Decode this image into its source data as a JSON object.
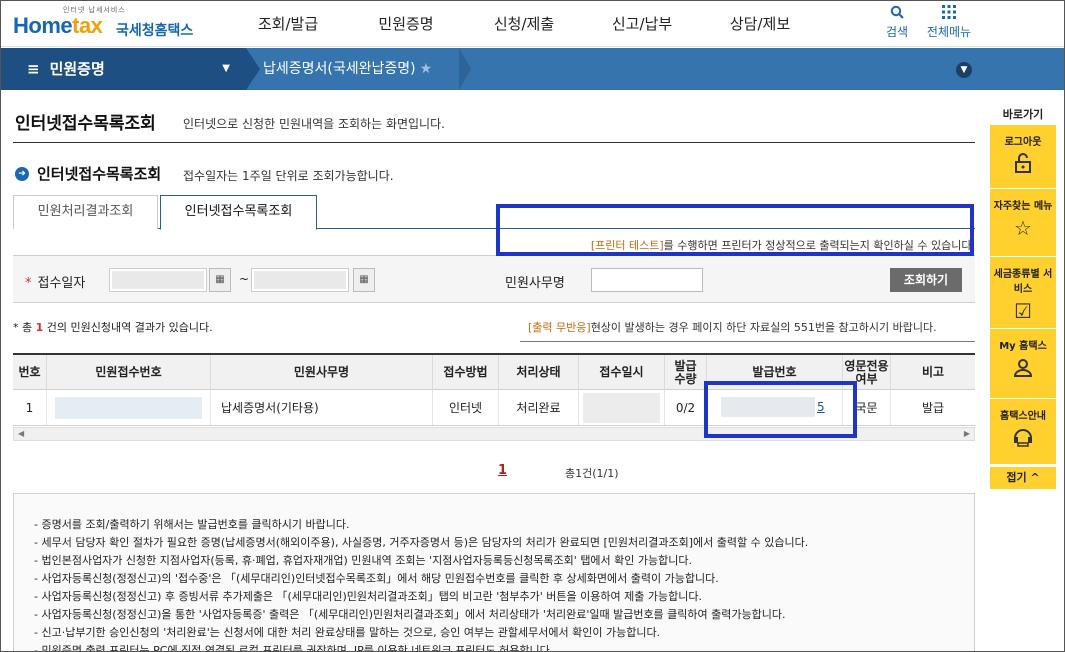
{
  "header": {
    "logo_tagline": "인터넷 납세서비스",
    "logo_brand_a": "Home",
    "logo_brand_b": "tax",
    "logo_kr": "국세청홈택스",
    "menu": [
      "조회/발급",
      "민원증명",
      "신청/제출",
      "신고/납부",
      "상담/제보"
    ],
    "search_label": "검색",
    "allmenu_label": "전체메뉴"
  },
  "location": {
    "level1": "민원증명",
    "level2": "납세증명서(국세완납증명)"
  },
  "page": {
    "title": "인터넷접수목록조회",
    "desc": "인터넷으로 신청한 민원내역을 조회하는 화면입니다.",
    "section_title": "인터넷접수목록조회",
    "section_desc": "접수일자는 1주일 단위로 조회가능합니다."
  },
  "tabs": [
    {
      "label": "민원처리결과조회",
      "active": false
    },
    {
      "label": "인터넷접수목록조회",
      "active": true
    }
  ],
  "printer_notice": {
    "highlight": "[프린터 테스트]",
    "text": "를 수행하면 프린터가 정상적으로 출력되는지 확인하실 수 있습니다."
  },
  "search": {
    "date_label": "접수일자",
    "tilde": "~",
    "office_label": "민원사무명",
    "button": "조회하기"
  },
  "result": {
    "prefix": "* 총 ",
    "count": "1",
    "suffix": " 건의 민원신청내역 결과가 있습니다."
  },
  "warning": {
    "highlight": "[출력 무반응]",
    "text": "현상이 발생하는 경우 페이지 하단 자료실의 551번을 참고하시기 바랍니다."
  },
  "table": {
    "headers": [
      "번호",
      "민원접수번호",
      "민원사무명",
      "접수방법",
      "처리상태",
      "접수일시",
      "발급\n수량",
      "발급번호",
      "영문전용\n여부",
      "비고"
    ],
    "rows": [
      {
        "no": "1",
        "office": "납세증명서(기타용)",
        "method": "인터넷",
        "status": "처리완료",
        "qty": "0/2",
        "issue_suffix": "5",
        "lang": "국문",
        "note": "발급"
      }
    ]
  },
  "paging": {
    "current": "1",
    "total": "총1건(1/1)"
  },
  "info": [
    "- 증명서를 조회/출력하기 위해서는 발급번호를 클릭하시기 바랍니다.",
    "- 세무서 담당자 확인 절차가 필요한 증명(납세증명서(해외이주용), 사실증명, 거주자증명서 등)은 담당자의 처리가 완료되면 [민원처리결과조회]에서 출력할 수 있습니다.",
    "- 법인본점사업자가 신청한 지점사업자(등록, 휴·폐업, 휴업자재개업) 민원내역 조회는 '지점사업자등록등신청목록조회' 탭에서 확인 가능합니다.",
    "- 사업자등록신청(정정신고)의 '접수중'은 「(세무대리인)인터넷접수목록조회」에서 해당 민원접수번호를 클릭한 후 상세화면에서 출력이 가능합니다.",
    "- 사업자등록신청(정정신고) 후 증빙서류 추가제출은 「(세무대리인)민원처리결과조회」탭의 비고란 '첨부추가' 버튼을 이용하여 제출 가능합니다.",
    "- 사업자등록신청(정정신고)을 통한 '사업자등록증' 출력은 「(세무대리인)민원처리결과조회」에서 처리상태가 '처리완료'일때 발급번호를 클릭하여 출력가능합니다.",
    "- 신고·납부기한 승인신청의 '처리완료'는 신청서에 대한 처리 완료상태를 말하는 것으로, 승인 여부는 관할세무서에서 확인이 가능합니다.",
    "- 민원증명 출력 프린터는 PC에 직접 연결된 로컬 프린터를 권장하며, IP를 이용한 네트워크 프린터도 허용합니다."
  ],
  "quick": {
    "head": "바로가기",
    "items": [
      "로그아웃",
      "자주찾는 메뉴",
      "세금종류별 서비스",
      "My 홈택스",
      "홈택스안내"
    ],
    "close": "접기 ^"
  },
  "colors": {
    "brand": "#1667b5",
    "locbar": "#3574ad",
    "locbar_dark": "#1e4f82",
    "highlight_box": "#1f35c7",
    "quick_yellow": "#ffd02e"
  }
}
